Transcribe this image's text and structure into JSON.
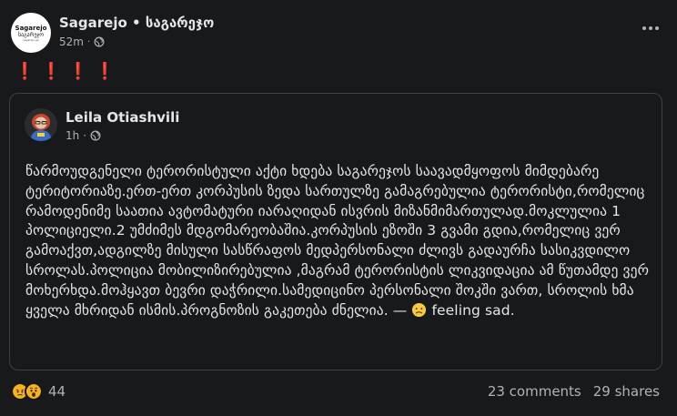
{
  "post": {
    "page_name": "Sagarejo • საგარეჯო",
    "time": "52m",
    "visibility_icon": "globe-icon",
    "more_icon": "more-options-icon",
    "exclamations": "❗❗❗❗",
    "avatar_logo": {
      "line1": "Sagarejo",
      "line2": "საგარეჯო",
      "line3": "sagarejo.ge"
    }
  },
  "shared_post": {
    "author": "Leila Otiashvili",
    "time": "1h",
    "visibility_icon": "globe-icon",
    "text": "წარმოუდგენელი ტერორისტული აქტი ხდება საგარეჯოს საავადმყოფოს მიმდებარე ტერიტორიაზე.ერთ-ერთ კორპუსის ზედა სართულზე გამაგრებულია ტერორისტი,რომელიც რამოდენიმე საათია ავტომატური იარაღიდან ისვრის მიზანმიმართულად.მოკლულია 1 პოლიციელი.2 უმძიმეს მდგომარეობაშია.კორპუსის ეზოში 3 გვამი გდია,რომელიც ვერ გამოაქვთ,ადგილზე მისული სასწრაფოს მედპერსონალი ძლივს გადაურჩა სასიკვდილო სროლას.პოლიცია მობილიზირებულია ,მაგრამ ტერორისტის ლიკვიდაცია ამ წუთამდე ვერ მოხერხდა.მოჰყავთ ბევრი დაჭრილი.სამედიცინო პერსონალი შოკში ვართ, სროლის ხმა ყველა მხრიდან ისმის.პროგნოზის გაკეთება ძნელია. — ",
    "feeling_icon": "sad-face-icon",
    "feeling": "feeling sad."
  },
  "footer": {
    "reactions": [
      "sad-reaction-icon",
      "wow-reaction-icon"
    ],
    "reaction_count": "44",
    "comments": "23 comments",
    "shares": "29 shares"
  },
  "colors": {
    "background": "#18191a",
    "border": "#3e4042",
    "text_primary": "#e4e6eb",
    "text_secondary": "#b0b3b8",
    "exclamation": "#e02f2f",
    "reaction_yellow": "#f7b125"
  }
}
